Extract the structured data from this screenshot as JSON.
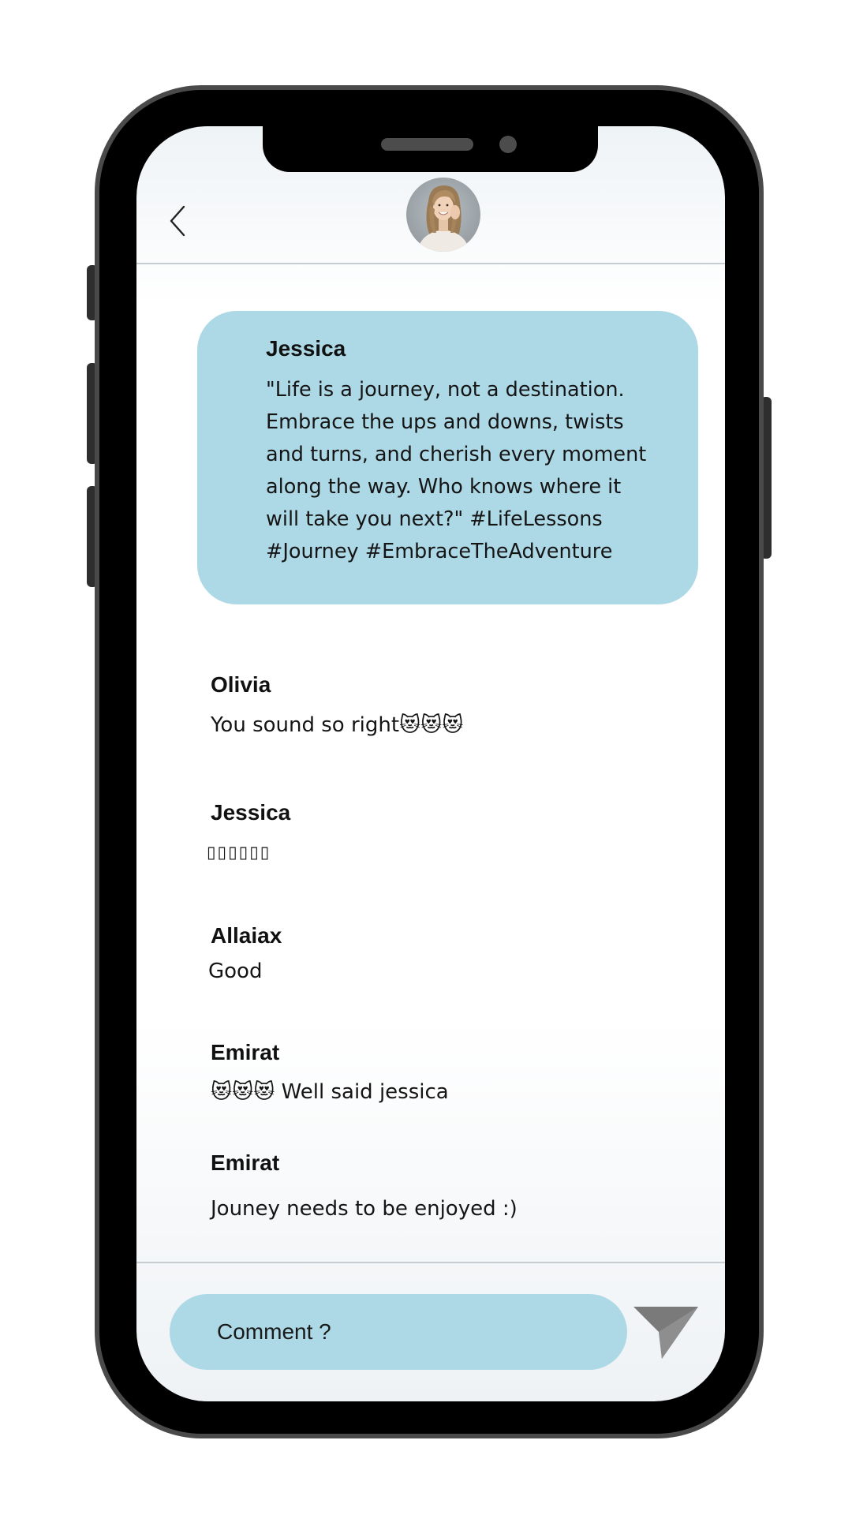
{
  "header": {
    "back_icon": "chevron-left-icon",
    "avatar_alt": "profile photo"
  },
  "post": {
    "author": "Jessica",
    "text": "\"Life is a journey, not a destination.\nEmbrace the ups and downs, twists\nand turns, and cherish every moment\nalong the way. Who knows where it\nwill take you next?\" #LifeLessons\n#Journey #EmbraceTheAdventure"
  },
  "comments": [
    {
      "name": "Olivia",
      "text": "You sound so right😻😻😻"
    },
    {
      "name": "Jessica",
      "text": "▯▯▯▯▯▯"
    },
    {
      "name": "Allaiax",
      "text": "Good"
    },
    {
      "name": "Emirat",
      "text": "😻😻😻 Well said jessica"
    },
    {
      "name": "Emirat",
      "text": "Jouney needs to be  enjoyed :)"
    }
  ],
  "composer": {
    "placeholder": "Comment ?",
    "send_icon": "send-icon"
  },
  "colors": {
    "bubble": "#add8e6",
    "frame": "#000000",
    "frame_border": "#4a4a4a",
    "send_icon": "#7a7a7a"
  }
}
